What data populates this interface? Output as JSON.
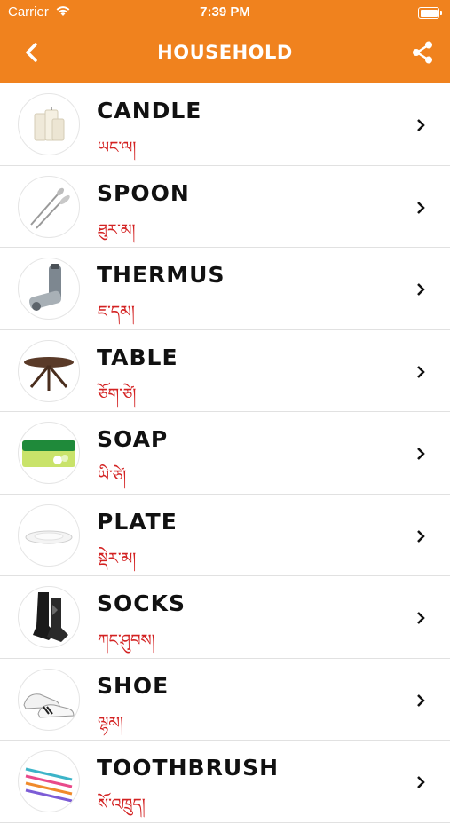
{
  "status": {
    "carrier": "Carrier",
    "time": "7:39 PM"
  },
  "nav": {
    "title": "HOUSEHOLD",
    "back_icon": "chevron-left-icon",
    "share_icon": "share-icon"
  },
  "colors": {
    "header": "#f0821e",
    "tibetan_text": "#d32222",
    "divider": "#e1e1e1"
  },
  "items": [
    {
      "name": "CANDLE",
      "tibetan": "ཡང་ལ།",
      "image": "candle"
    },
    {
      "name": "SPOON",
      "tibetan": "ཐུར་མ།",
      "image": "spoon"
    },
    {
      "name": "THERMUS",
      "tibetan": "ཇ་དམ།",
      "image": "thermos"
    },
    {
      "name": "TABLE",
      "tibetan": "ཅོག་ཙེ།",
      "image": "table"
    },
    {
      "name": "SOAP",
      "tibetan": "ཡི་ཙེ།",
      "image": "soap"
    },
    {
      "name": "PLATE",
      "tibetan": "སྡེར་མ།",
      "image": "plate"
    },
    {
      "name": "SOCKS",
      "tibetan": "ཀང་ཤུབས།",
      "image": "socks"
    },
    {
      "name": "SHOE",
      "tibetan": "ལྷམ།",
      "image": "shoe"
    },
    {
      "name": "TOOTHBRUSH",
      "tibetan": "སོ་འཁྲུད།",
      "image": "toothbrush"
    }
  ]
}
